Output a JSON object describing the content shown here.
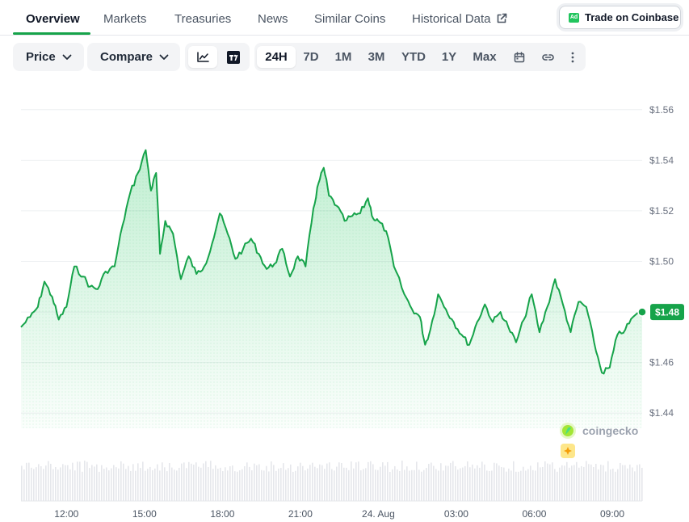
{
  "tabs": [
    {
      "label": "Overview",
      "active": true
    },
    {
      "label": "Markets"
    },
    {
      "label": "Treasuries"
    },
    {
      "label": "News"
    },
    {
      "label": "Similar Coins"
    },
    {
      "label": "Historical Data"
    }
  ],
  "ad_button": {
    "badge": "Ad",
    "label": "Trade on Coinbase"
  },
  "toolbar": {
    "price_label": "Price",
    "compare_label": "Compare",
    "ranges": [
      "24H",
      "7D",
      "1M",
      "3M",
      "YTD",
      "1Y",
      "Max"
    ],
    "active_range": "24H"
  },
  "colors": {
    "accent": "#16a34a",
    "line": "#16a34a",
    "badge": "#16a34a"
  },
  "watermark": "coingecko",
  "chart_data": {
    "type": "area",
    "title": "",
    "xlabel": "",
    "ylabel": "",
    "ylim": [
      1.434,
      1.566
    ],
    "y_ticks": [
      "$1.56",
      "$1.54",
      "$1.52",
      "$1.50",
      "$1.46",
      "$1.44"
    ],
    "y_tick_values": [
      1.56,
      1.54,
      1.52,
      1.5,
      1.46,
      1.44
    ],
    "x_ticks": [
      "12:00",
      "15:00",
      "18:00",
      "21:00",
      "24. Aug",
      "03:00",
      "06:00",
      "09:00"
    ],
    "x_tick_hours": [
      12,
      15,
      18,
      21,
      24,
      27,
      30,
      33
    ],
    "x_range_hours": [
      10.25,
      34.15
    ],
    "last_price_label": "$1.48",
    "last_price": 1.48,
    "series": [
      {
        "x_hours": [
          10.25,
          10.6,
          10.9,
          11.15,
          11.45,
          11.7,
          12.0,
          12.3,
          12.65,
          12.9,
          13.2,
          13.5,
          13.85,
          14.15,
          14.45,
          14.75,
          15.05,
          15.25,
          15.45,
          15.6,
          15.8,
          16.1,
          16.4,
          16.7,
          17.0,
          17.3,
          17.6,
          17.9,
          18.2,
          18.5,
          18.8,
          19.1,
          19.4,
          19.7,
          20.0,
          20.3,
          20.6,
          20.9,
          21.2,
          21.5,
          21.7,
          21.9,
          22.1,
          22.4,
          22.7,
          23.0,
          23.3,
          23.6,
          23.8,
          24.0,
          24.3,
          24.6,
          25.0,
          25.3,
          25.6,
          25.8,
          26.0,
          26.3,
          26.6,
          26.9,
          27.2,
          27.5,
          27.8,
          28.1,
          28.4,
          28.7,
          29.0,
          29.3,
          29.6,
          29.9,
          30.2,
          30.5,
          30.8,
          31.1,
          31.4,
          31.7,
          32.0,
          32.3,
          32.6,
          32.9,
          33.2,
          33.5,
          33.8,
          34.15
        ],
        "y": [
          1.474,
          1.478,
          1.482,
          1.492,
          1.486,
          1.477,
          1.482,
          1.498,
          1.494,
          1.49,
          1.489,
          1.496,
          1.498,
          1.514,
          1.527,
          1.535,
          1.544,
          1.528,
          1.535,
          1.503,
          1.516,
          1.511,
          1.493,
          1.502,
          1.495,
          1.498,
          1.507,
          1.519,
          1.511,
          1.501,
          1.505,
          1.509,
          1.503,
          1.497,
          1.499,
          1.505,
          1.494,
          1.502,
          1.498,
          1.521,
          1.531,
          1.537,
          1.526,
          1.522,
          1.516,
          1.518,
          1.519,
          1.525,
          1.517,
          1.516,
          1.512,
          1.498,
          1.487,
          1.481,
          1.478,
          1.467,
          1.473,
          1.487,
          1.481,
          1.476,
          1.471,
          1.467,
          1.476,
          1.483,
          1.476,
          1.48,
          1.474,
          1.468,
          1.477,
          1.487,
          1.472,
          1.482,
          1.493,
          1.483,
          1.472,
          1.484,
          1.482,
          1.468,
          1.456,
          1.458,
          1.471,
          1.473,
          1.478,
          1.48
        ],
        "volume_present": true
      }
    ]
  }
}
